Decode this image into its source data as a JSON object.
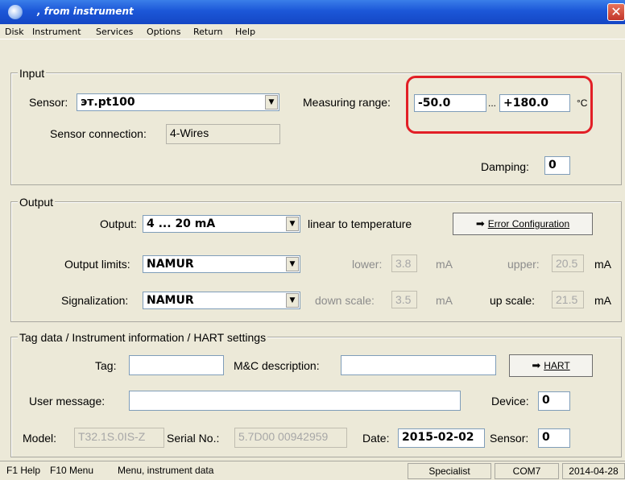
{
  "window": {
    "title": ", from instrument",
    "close_glyph": "✕"
  },
  "menu": [
    "Disk",
    "Instrument",
    "Services",
    "Options",
    "Return",
    "Help"
  ],
  "input": {
    "group_label": "Input",
    "sensor_label": "Sensor:",
    "sensor_value": "эт.pt100",
    "measuring_label": "Measuring range:",
    "range_low": "-50.0",
    "range_sep": "...",
    "range_high": "+180.0",
    "range_unit": "°C",
    "connection_label": "Sensor connection:",
    "connection_value": "4-Wires",
    "damping_label": "Damping:",
    "damping_value": "0"
  },
  "output": {
    "group_label": "Output",
    "output_label": "Output:",
    "output_value": "4 ... 20 mA",
    "linear_text": "linear to temperature",
    "error_button": "Error Configuration",
    "limits_label": "Output limits:",
    "limits_value": "NAMUR",
    "lower_label": "lower:",
    "lower_value": "3.8",
    "lower_unit": "mA",
    "upper_label": "upper:",
    "upper_value": "20.5",
    "upper_unit": "mA",
    "signal_label": "Signalization:",
    "signal_value": "NAMUR",
    "down_label": "down scale:",
    "down_value": "3.5",
    "down_unit": "mA",
    "up_label": "up scale:",
    "up_value": "21.5",
    "up_unit": "mA"
  },
  "tag": {
    "group_label": "Tag data / Instrument information / HART settings",
    "tag_label": "Tag:",
    "tag_value": "",
    "mc_label": "M&C description:",
    "mc_value": "",
    "hart_button": "HART",
    "user_label": "User message:",
    "user_value": "",
    "device_label": "Device:",
    "device_value": "0",
    "model_label": "Model:",
    "model_value": "T32.1S.0IS-Z",
    "serial_label": "Serial No.:",
    "serial_value": "5.7D00 00942959",
    "date_label": "Date:",
    "date_value": "2015-02-02",
    "sensor_label": "Sensor:",
    "sensor_value": "0"
  },
  "status": {
    "help": "F1 Help",
    "menu": "F10 Menu",
    "context": "Menu, instrument data",
    "level": "Specialist",
    "port": "COM7",
    "date": "2014-04-28"
  },
  "annotation": {
    "highlight_color": "#e21f26"
  }
}
